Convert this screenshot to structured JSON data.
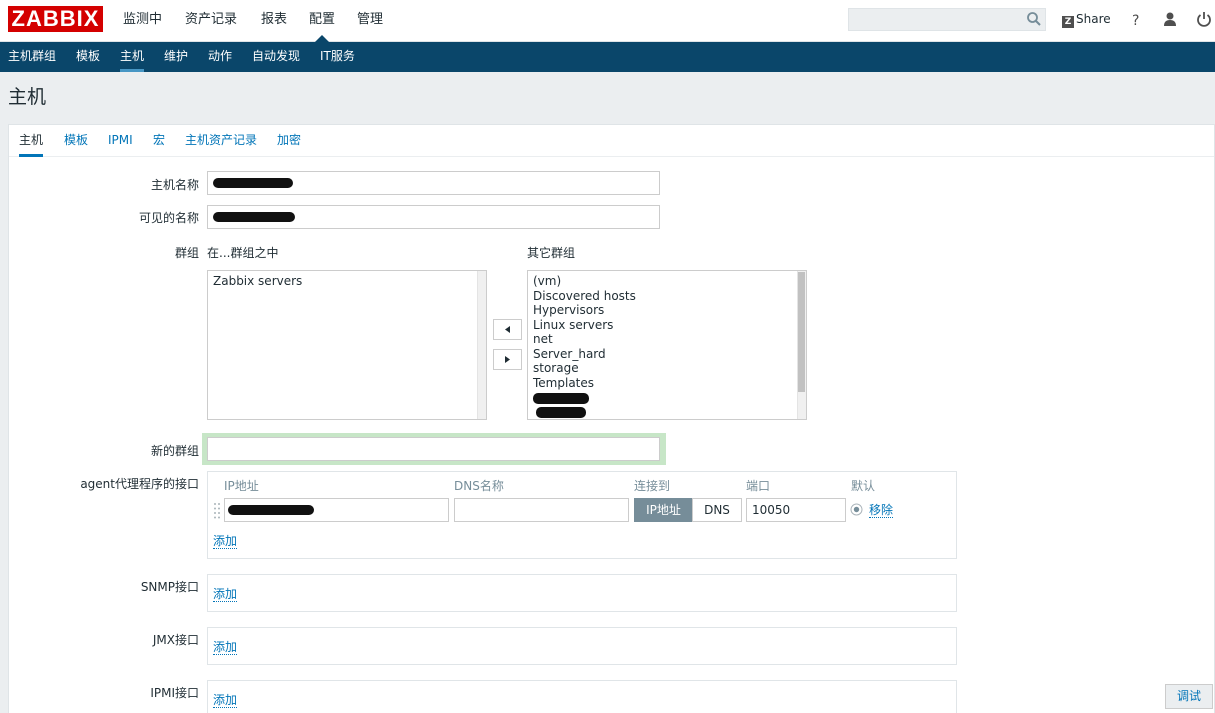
{
  "header": {
    "logo": "ZABBIX",
    "menu": [
      "监测中",
      "资产记录",
      "报表",
      "配置",
      "管理"
    ],
    "selected_menu": "配置",
    "search": {
      "value": "",
      "placeholder": ""
    },
    "share_label": "Share",
    "icons": [
      "search-icon",
      "help-icon",
      "user-icon",
      "power-icon"
    ]
  },
  "submenu": {
    "items": [
      "主机群组",
      "模板",
      "主机",
      "维护",
      "动作",
      "自动发现",
      "IT服务"
    ],
    "selected": "主机"
  },
  "page": {
    "title": "主机"
  },
  "tabs": {
    "items": [
      "主机",
      "模板",
      "IPMI",
      "宏",
      "主机资产记录",
      "加密"
    ],
    "active": "主机"
  },
  "form": {
    "host_name": {
      "label": "主机名称",
      "value": ""
    },
    "visible_name": {
      "label": "可见的名称",
      "value": ""
    },
    "groups": {
      "label": "群组",
      "in_groups_label": "在...群组之中",
      "other_groups_label": "其它群组",
      "in_groups": [
        "Zabbix servers"
      ],
      "other_groups": [
        "(vm)",
        "Discovered hosts",
        "Hypervisors",
        "Linux servers",
        "net",
        "Server_hard",
        "storage",
        "Templates"
      ]
    },
    "new_group": {
      "label": "新的群组",
      "value": ""
    },
    "agent_interface": {
      "label": "agent代理程序的接口",
      "columns": [
        "IP地址",
        "DNS名称",
        "连接到",
        "端口",
        "默认"
      ],
      "ip": "",
      "dns": "",
      "connect_options": [
        "IP地址",
        "DNS"
      ],
      "connect_selected": "IP地址",
      "port": "10050",
      "remove_label": "移除",
      "add_label": "添加"
    },
    "snmp_interface": {
      "label": "SNMP接口",
      "add_label": "添加"
    },
    "jmx_interface": {
      "label": "JMX接口",
      "add_label": "添加"
    },
    "ipmi_interface": {
      "label": "IPMI接口",
      "add_label": "添加"
    }
  },
  "footer": {
    "test_button": "调试"
  },
  "colors": {
    "brand": "#d40000",
    "nav": "#0a466a",
    "link": "#0275b8",
    "selected_btn": "#768d99"
  }
}
